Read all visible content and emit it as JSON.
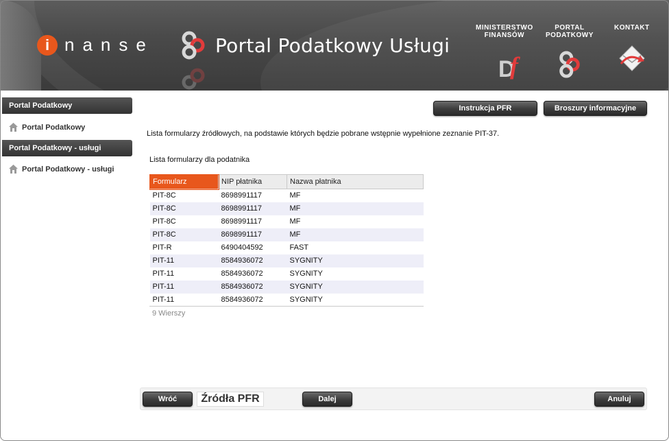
{
  "header": {
    "brand_initial": "i",
    "brand_rest": "nanse",
    "portal_title": "Portal Podatkowy Usługi",
    "links": [
      {
        "label": "MINISTERSTWO\nFINANSÓW",
        "icon": "ministry-df-logo"
      },
      {
        "label": "PORTAL\nPODATKOWY",
        "icon": "portal-podatkowy-logo"
      },
      {
        "label": "KONTAKT",
        "icon": "envelope-icon"
      }
    ]
  },
  "sidebar": {
    "sections": [
      {
        "heading": "Portal Podatkowy",
        "item": "Portal Podatkowy"
      },
      {
        "heading": "Portal Podatkowy - usługi",
        "item": "Portal Podatkowy - usługi"
      }
    ]
  },
  "toolbar": {
    "instrukcja_label": "Instrukcja PFR",
    "broszury_label": "Broszury informacyjne"
  },
  "main": {
    "info_text": "Lista formularzy źródłowych, na podstawie których będzie pobrane wstępnie wypełnione zeznanie PIT-37.",
    "list_title": "Lista formularzy dla podatnika",
    "columns": [
      "Formularz",
      "NIP płatnika",
      "Nazwa płatnika"
    ],
    "rows": [
      [
        "PIT-8C",
        "8698991117",
        "MF"
      ],
      [
        "PIT-8C",
        "8698991117",
        "MF"
      ],
      [
        "PIT-8C",
        "8698991117",
        "MF"
      ],
      [
        "PIT-8C",
        "8698991117",
        "MF"
      ],
      [
        "PIT-R",
        "6490404592",
        "FAST"
      ],
      [
        "PIT-11",
        "8584936072",
        "SYGNITY"
      ],
      [
        "PIT-11",
        "8584936072",
        "SYGNITY"
      ],
      [
        "PIT-11",
        "8584936072",
        "SYGNITY"
      ],
      [
        "PIT-11",
        "8584936072",
        "SYGNITY"
      ]
    ],
    "rows_count": "9 Wierszy"
  },
  "footer": {
    "back_label": "Wróć",
    "step_label": "Źródła PFR",
    "next_label": "Dalej",
    "cancel_label": "Anuluj"
  },
  "colors": {
    "accent": "#e8571c",
    "header_bg": "#4a4a4a",
    "row_alt": "#eeeef8"
  }
}
